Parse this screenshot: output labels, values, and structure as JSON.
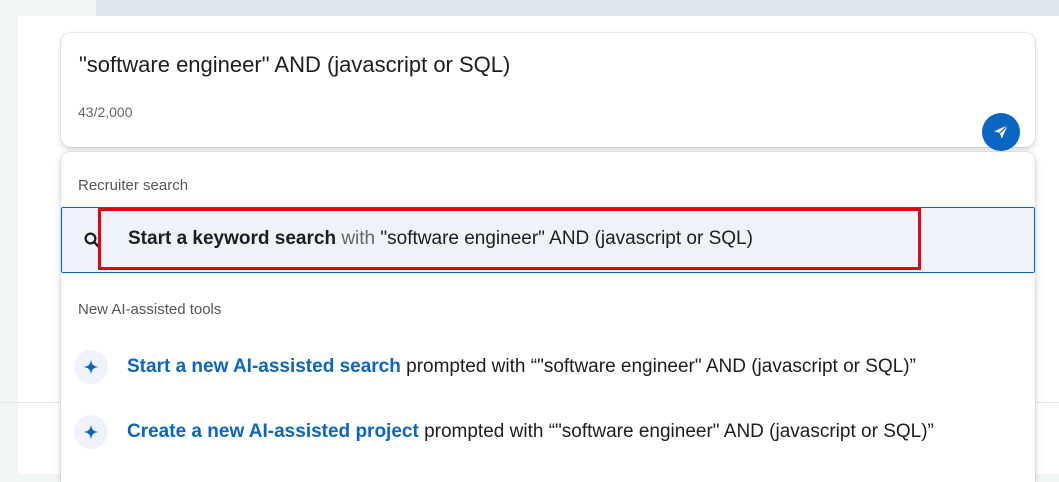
{
  "search": {
    "query": "\"software engineer\" AND (javascript or SQL)",
    "char_count": "43/2,000",
    "send_icon": "paper-plane-icon"
  },
  "dropdown": {
    "recruiter_header": "Recruiter search",
    "keyword_item": {
      "icon": "search-icon",
      "action": "Start a keyword search",
      "connector": " with ",
      "value": "\"software engineer\" AND (javascript or SQL)"
    },
    "ai_header": "New AI-assisted tools",
    "ai_items": [
      {
        "icon": "sparkle-icon",
        "link": "Start a new AI-assisted search",
        "rest": " prompted with “\"software engineer\" AND (javascript or SQL)”"
      },
      {
        "icon": "sparkle-icon",
        "link": "Create a new AI-assisted project",
        "rest": " prompted with “\"software engineer\" AND (javascript or SQL)”"
      }
    ]
  },
  "colors": {
    "accent": "#0a66c2",
    "highlight_border": "#e60012",
    "selected_row_bg": "#edf3f8"
  }
}
